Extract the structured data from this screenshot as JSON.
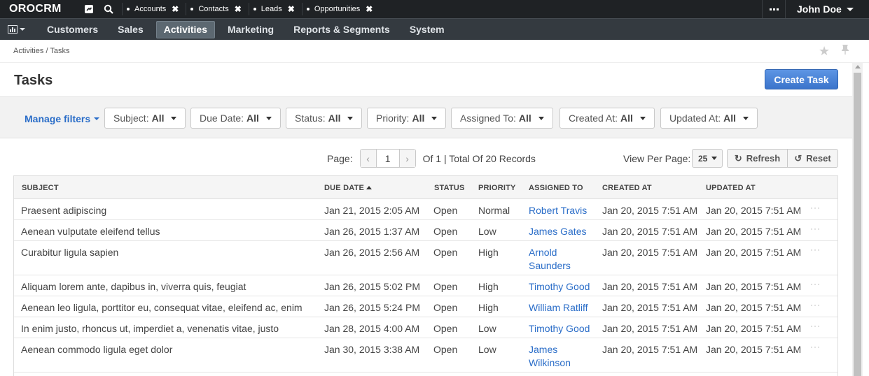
{
  "app": {
    "logo": "OROCRM"
  },
  "pinned_tabs": [
    {
      "label": "Accounts"
    },
    {
      "label": "Contacts"
    },
    {
      "label": "Leads"
    },
    {
      "label": "Opportunities"
    }
  ],
  "user": {
    "name": "John Doe"
  },
  "nav": {
    "items": [
      {
        "label": "Customers"
      },
      {
        "label": "Sales"
      },
      {
        "label": "Activities",
        "active": true
      },
      {
        "label": "Marketing"
      },
      {
        "label": "Reports & Segments"
      },
      {
        "label": "System"
      }
    ]
  },
  "breadcrumb": "Activities / Tasks",
  "page": {
    "title": "Tasks",
    "create_label": "Create Task"
  },
  "filters": {
    "manage_label": "Manage filters",
    "items": [
      {
        "label": "Subject:",
        "value": "All"
      },
      {
        "label": "Due Date:",
        "value": "All"
      },
      {
        "label": "Status:",
        "value": "All"
      },
      {
        "label": "Priority:",
        "value": "All"
      },
      {
        "label": "Assigned To:",
        "value": "All"
      },
      {
        "label": "Created At:",
        "value": "All"
      },
      {
        "label": "Updated At:",
        "value": "All"
      }
    ]
  },
  "pager": {
    "page_label": "Page:",
    "current_page": "1",
    "summary": "Of 1 | Total Of 20 Records",
    "view_per_page_label": "View Per Page:",
    "per_page": "25",
    "refresh_label": "Refresh",
    "reset_label": "Reset"
  },
  "grid": {
    "columns": [
      "SUBJECT",
      "DUE DATE",
      "STATUS",
      "PRIORITY",
      "ASSIGNED TO",
      "CREATED AT",
      "UPDATED AT"
    ],
    "rows": [
      {
        "subject": "Praesent adipiscing",
        "due": "Jan 21, 2015 2:05 AM",
        "status": "Open",
        "priority": "Normal",
        "assigned": [
          "Robert Travis"
        ],
        "created": "Jan 20, 2015 7:51 AM",
        "updated": "Jan 20, 2015 7:51 AM"
      },
      {
        "subject": "Aenean vulputate eleifend tellus",
        "due": "Jan 26, 2015 1:37 AM",
        "status": "Open",
        "priority": "Low",
        "assigned": [
          "James Gates"
        ],
        "created": "Jan 20, 2015 7:51 AM",
        "updated": "Jan 20, 2015 7:51 AM"
      },
      {
        "subject": "Curabitur ligula sapien",
        "due": "Jan 26, 2015 2:56 AM",
        "status": "Open",
        "priority": "High",
        "assigned": [
          "Arnold",
          "Saunders"
        ],
        "created": "Jan 20, 2015 7:51 AM",
        "updated": "Jan 20, 2015 7:51 AM"
      },
      {
        "subject": "Aliquam lorem ante, dapibus in, viverra quis, feugiat",
        "due": "Jan 26, 2015 5:02 PM",
        "status": "Open",
        "priority": "High",
        "assigned": [
          "Timothy Good"
        ],
        "created": "Jan 20, 2015 7:51 AM",
        "updated": "Jan 20, 2015 7:51 AM"
      },
      {
        "subject": "Aenean leo ligula, porttitor eu, consequat vitae, eleifend ac, enim",
        "due": "Jan 26, 2015 5:24 PM",
        "status": "Open",
        "priority": "High",
        "assigned": [
          "William Ratliff"
        ],
        "created": "Jan 20, 2015 7:51 AM",
        "updated": "Jan 20, 2015 7:51 AM"
      },
      {
        "subject": "In enim justo, rhoncus ut, imperdiet a, venenatis vitae, justo",
        "due": "Jan 28, 2015 4:00 AM",
        "status": "Open",
        "priority": "Low",
        "assigned": [
          "Timothy Good"
        ],
        "created": "Jan 20, 2015 7:51 AM",
        "updated": "Jan 20, 2015 7:51 AM"
      },
      {
        "subject": "Aenean commodo ligula eget dolor",
        "due": "Jan 30, 2015 3:38 AM",
        "status": "Open",
        "priority": "Low",
        "assigned": [
          "James",
          "Wilkinson"
        ],
        "created": "Jan 20, 2015 7:51 AM",
        "updated": "Jan 20, 2015 7:51 AM"
      }
    ]
  }
}
